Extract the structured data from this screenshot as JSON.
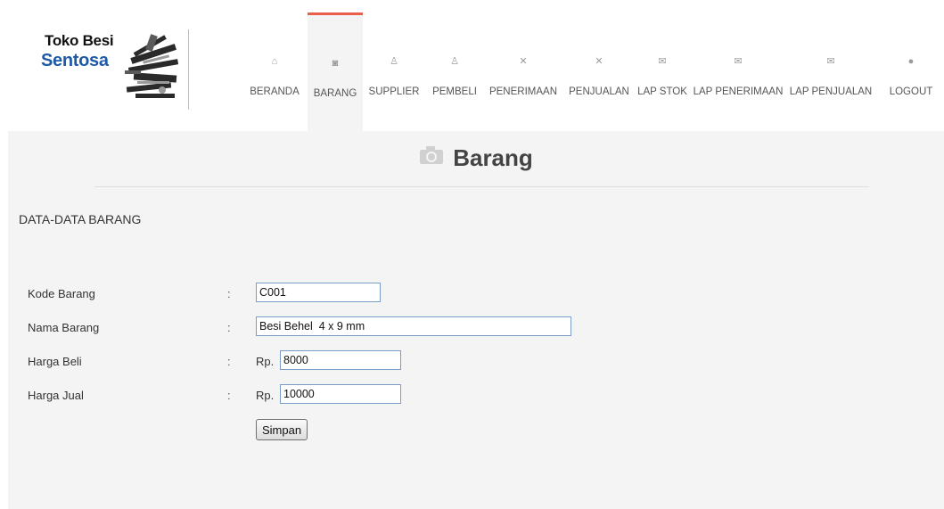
{
  "brand": {
    "line1": "Toko Besi",
    "line2": "Sentosa"
  },
  "nav": [
    {
      "label": "BERANDA",
      "icon": "home-icon",
      "glyph": "⌂"
    },
    {
      "label": "BARANG",
      "icon": "camera-icon",
      "glyph": "◙"
    },
    {
      "label": "SUPPLIER",
      "icon": "user-icon",
      "glyph": "♙"
    },
    {
      "label": "PEMBELI",
      "icon": "user-icon",
      "glyph": "♙"
    },
    {
      "label": "PENERIMAAN",
      "icon": "tools-icon",
      "glyph": "✕"
    },
    {
      "label": "PENJUALAN",
      "icon": "tools-icon",
      "glyph": "✕"
    },
    {
      "label": "LAP STOK",
      "icon": "envelope-icon",
      "glyph": "✉"
    },
    {
      "label": "LAP PENERIMAAN",
      "icon": "envelope-icon",
      "glyph": "✉"
    },
    {
      "label": "LAP PENJUALAN",
      "icon": "envelope-icon",
      "glyph": "✉"
    },
    {
      "label": "LOGOUT",
      "icon": "chat-icon",
      "glyph": "●"
    }
  ],
  "page": {
    "title": "Barang",
    "section": "DATA-DATA BARANG"
  },
  "form": {
    "kode": {
      "label": "Kode Barang",
      "value": "C001"
    },
    "nama": {
      "label": "Nama Barang",
      "value": "Besi Behel  4 x 9 mm"
    },
    "beli": {
      "label": "Harga Beli",
      "prefix": "Rp.",
      "value": "8000"
    },
    "jual": {
      "label": "Harga Jual",
      "prefix": "Rp.",
      "value": "10000"
    },
    "colon": ":",
    "submit": "Simpan"
  },
  "colors": {
    "accent": "#e8604c",
    "brand": "#1e5aa8",
    "content_bg": "#f4f4f4"
  }
}
